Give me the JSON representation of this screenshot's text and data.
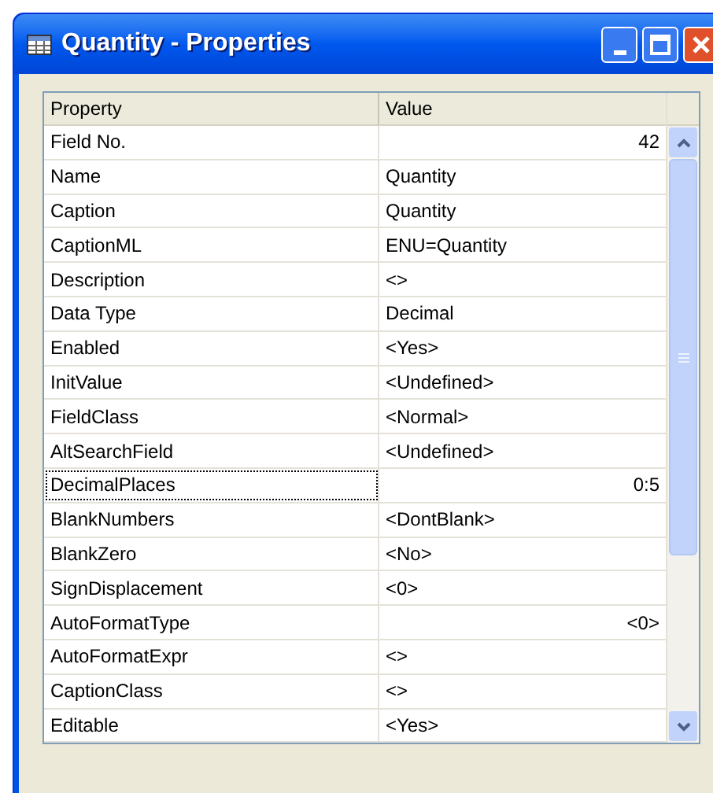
{
  "window": {
    "title": "Quantity - Properties"
  },
  "table": {
    "columns": [
      "Property",
      "Value"
    ],
    "rows": [
      {
        "property": "Field No.",
        "value": "42",
        "kind": "number",
        "selected": false
      },
      {
        "property": "Name",
        "value": "Quantity",
        "kind": "text",
        "selected": false
      },
      {
        "property": "Caption",
        "value": "Quantity",
        "kind": "text",
        "selected": false
      },
      {
        "property": "CaptionML",
        "value": "ENU=Quantity",
        "kind": "text",
        "selected": false
      },
      {
        "property": "Description",
        "value": "<>",
        "kind": "text",
        "selected": false
      },
      {
        "property": "Data Type",
        "value": "Decimal",
        "kind": "text",
        "selected": false
      },
      {
        "property": "Enabled",
        "value": "<Yes>",
        "kind": "text",
        "selected": false
      },
      {
        "property": "InitValue",
        "value": "<Undefined>",
        "kind": "text",
        "selected": false
      },
      {
        "property": "FieldClass",
        "value": "<Normal>",
        "kind": "text",
        "selected": false
      },
      {
        "property": "AltSearchField",
        "value": "<Undefined>",
        "kind": "text",
        "selected": false
      },
      {
        "property": "DecimalPlaces",
        "value": "0:5",
        "kind": "number",
        "selected": true
      },
      {
        "property": "BlankNumbers",
        "value": "<DontBlank>",
        "kind": "text",
        "selected": false
      },
      {
        "property": "BlankZero",
        "value": "<No>",
        "kind": "text",
        "selected": false
      },
      {
        "property": "SignDisplacement",
        "value": "<0>",
        "kind": "text",
        "selected": false
      },
      {
        "property": "AutoFormatType",
        "value": "<0>",
        "kind": "number",
        "selected": false
      },
      {
        "property": "AutoFormatExpr",
        "value": "<>",
        "kind": "text",
        "selected": false
      },
      {
        "property": "CaptionClass",
        "value": "<>",
        "kind": "text",
        "selected": false
      },
      {
        "property": "Editable",
        "value": "<Yes>",
        "kind": "text",
        "selected": false
      }
    ]
  }
}
